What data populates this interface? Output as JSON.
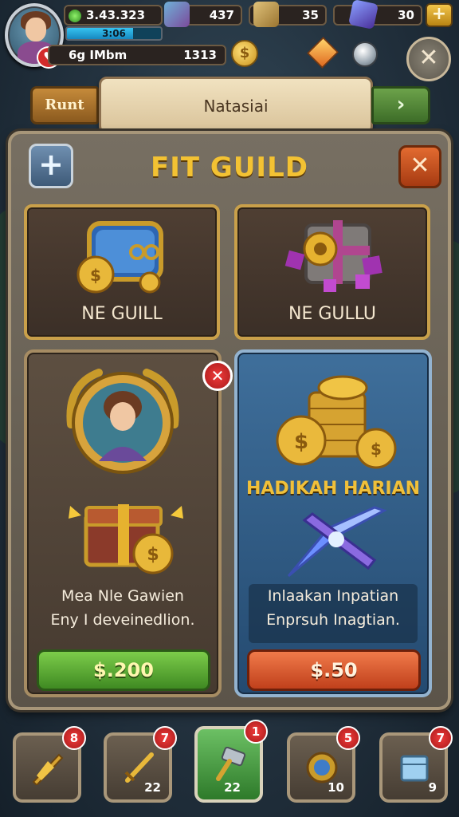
{
  "hud": {
    "gold": "3.43.323",
    "xp_text": "3:06",
    "xp_fill": 0.7,
    "level_text": "6g IMbm",
    "coins_small": "1313",
    "resource_1": "437",
    "resource_2": "35",
    "resource_3": "30",
    "plus_label": "+",
    "close_label": "✕",
    "heart_label": "♥"
  },
  "header": {
    "left_tab": "Runt",
    "title": "Natasiai",
    "right_tab": "›"
  },
  "panel": {
    "title": "FIT GUILD",
    "add_label": "+",
    "close_label": "✕"
  },
  "cards": {
    "card1_label": "NE GUILL",
    "card2_label": "NE GULLU",
    "offer_left": {
      "x_label": "✕",
      "desc_line1": "Mea Nle Gawien",
      "desc_line2": "Eny I deveinedlion.",
      "price": "$.200"
    },
    "offer_right": {
      "title": "HADIKAH HARIAN",
      "desc_line1": "Inlaakan Inpatian",
      "desc_line2": "Enprsuh Inagtian.",
      "price": "$.50"
    }
  },
  "dock": [
    {
      "name": "dock-slot-shield",
      "badge": "8",
      "count": ""
    },
    {
      "name": "dock-slot-sword",
      "badge": "7",
      "count": "22"
    },
    {
      "name": "dock-slot-hammer",
      "badge": "1",
      "count": "22"
    },
    {
      "name": "dock-slot-gear",
      "badge": "5",
      "count": "10"
    },
    {
      "name": "dock-slot-crate",
      "badge": "7",
      "count": "9"
    }
  ]
}
